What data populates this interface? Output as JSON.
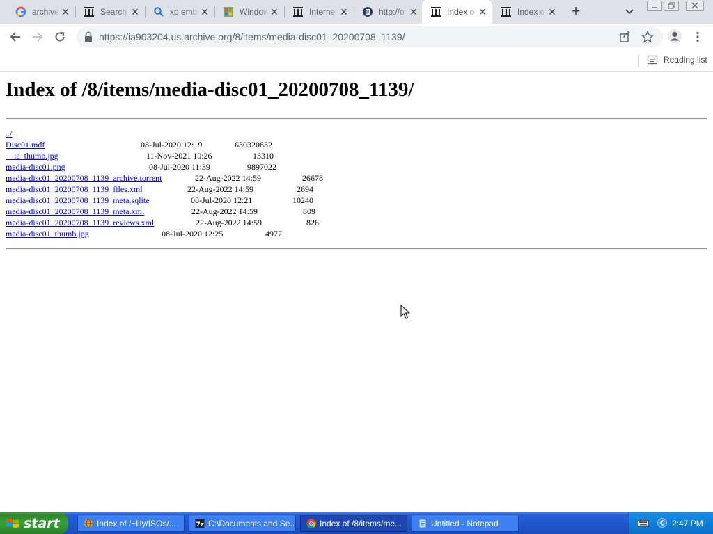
{
  "browser": {
    "tabs": [
      {
        "title": "archive",
        "icon": "google-icon"
      },
      {
        "title": "Search",
        "icon": "archive-icon"
      },
      {
        "title": "xp emb",
        "icon": "search-icon"
      },
      {
        "title": "Window",
        "icon": "windows-icon"
      },
      {
        "title": "Interne",
        "icon": "archive-icon"
      },
      {
        "title": "http://o",
        "icon": "document-icon"
      },
      {
        "title": "Index o",
        "icon": "archive-icon",
        "active": true
      },
      {
        "title": "Index o",
        "icon": "archive-icon"
      }
    ],
    "url_host": "https://ia903204.us.archive.org",
    "url_path": "/8/items/media-disc01_20200708_1139/",
    "reading_list_label": "Reading list"
  },
  "page": {
    "title": "Index of /8/items/media-disc01_20200708_1139/",
    "parent_link": "../",
    "files": [
      {
        "name": "Disc01.mdf",
        "date": "08-Jul-2020 12:19",
        "size": "630320832"
      },
      {
        "name": "__ia_thumb.jpg",
        "date": "11-Nov-2021 10:26",
        "size": "13310"
      },
      {
        "name": "media-disc01.png",
        "date": "08-Jul-2020 11:39",
        "size": "9897022"
      },
      {
        "name": "media-disc01_20200708_1139_archive.torrent",
        "date": "22-Aug-2022 14:59",
        "size": "26678"
      },
      {
        "name": "media-disc01_20200708_1139_files.xml",
        "date": "22-Aug-2022 14:59",
        "size": "2694"
      },
      {
        "name": "media-disc01_20200708_1139_meta.sqlite",
        "date": "08-Jul-2020 12:21",
        "size": "10240"
      },
      {
        "name": "media-disc01_20200708_1139_meta.xml",
        "date": "22-Aug-2022 14:59",
        "size": "809"
      },
      {
        "name": "media-disc01_20200708_1139_reviews.xml",
        "date": "22-Aug-2022 14:59",
        "size": "826"
      },
      {
        "name": "media-disc01_thumb.jpg",
        "date": "08-Jul-2020 12:25",
        "size": "4977"
      }
    ]
  },
  "taskbar": {
    "start_label": "start",
    "tasks": [
      {
        "label": "Index of /~lily/ISOs/...",
        "icon": "globe-icon"
      },
      {
        "label": "C:\\Documents and Se...",
        "icon": "7zip-icon"
      },
      {
        "label": "Index of /8/items/me...",
        "icon": "chrome-icon",
        "active": true
      },
      {
        "label": "Untitled - Notepad",
        "icon": "notepad-icon"
      }
    ],
    "clock": "2:47 PM"
  }
}
